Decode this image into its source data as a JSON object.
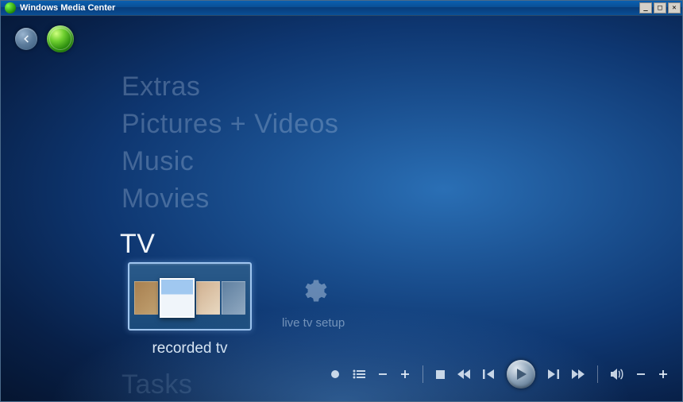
{
  "window": {
    "title": "Windows Media Center"
  },
  "menu": {
    "items": [
      {
        "label": "Extras"
      },
      {
        "label": "Pictures + Videos"
      },
      {
        "label": "Music"
      },
      {
        "label": "Movies"
      },
      {
        "label": "TV"
      },
      {
        "label": "Tasks"
      }
    ],
    "active_index": 4
  },
  "tv": {
    "tiles": [
      {
        "label": "recorded tv"
      },
      {
        "label": "live tv setup"
      }
    ]
  },
  "icons": {
    "back": "back-arrow",
    "orb": "media-center-orb",
    "gear": "gear"
  },
  "controls": {
    "record": "record",
    "channel_guide": "channel-guide",
    "channel_down": "channel-down",
    "channel_up": "channel-up",
    "stop": "stop",
    "rewind": "rewind",
    "skip_back": "skip-back",
    "play": "play",
    "skip_fwd": "skip-forward",
    "fast_fwd": "fast-forward",
    "mute": "mute",
    "vol_down": "volume-down",
    "vol_up": "volume-up"
  }
}
